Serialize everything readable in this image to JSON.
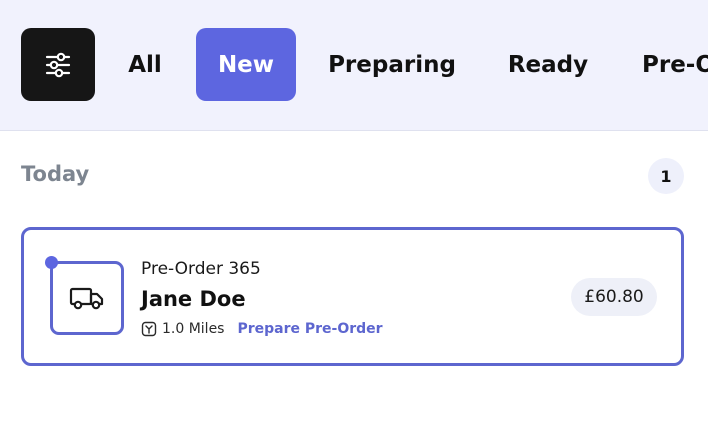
{
  "tabs": [
    {
      "label": "All",
      "active": false
    },
    {
      "label": "New",
      "active": true
    },
    {
      "label": "Preparing",
      "active": false
    },
    {
      "label": "Ready",
      "active": false
    },
    {
      "label": "Pre-Order",
      "active": false
    }
  ],
  "filter_icon": "sliders-icon",
  "section": {
    "title": "Today",
    "count": "1"
  },
  "orders": [
    {
      "ref": "Pre-Order 365",
      "customer": "Jane Doe",
      "distance": "1.0 Miles",
      "action": "Prepare Pre-Order",
      "price": "£60.80",
      "type_icon": "delivery-truck-icon",
      "distance_icon": "route-icon"
    }
  ],
  "colors": {
    "accent": "#5d66e0",
    "topbar_bg": "#f1f2fd",
    "filter_btn_bg": "#161616",
    "muted_text": "#7d8590"
  }
}
